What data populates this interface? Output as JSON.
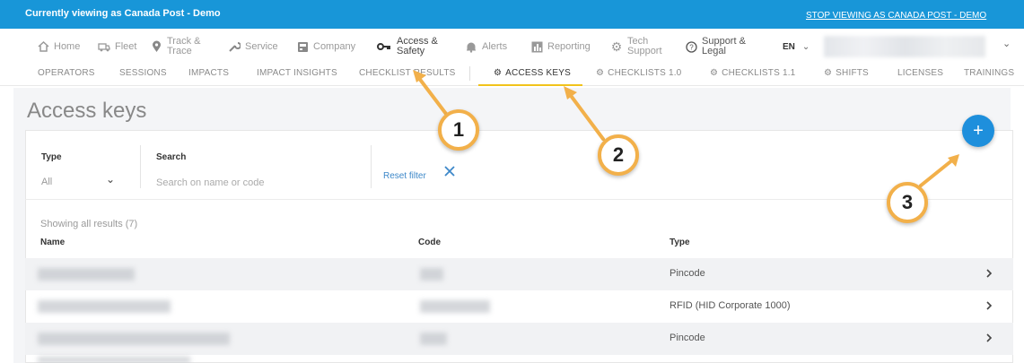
{
  "banner": {
    "text": "Currently viewing as Canada Post - Demo",
    "link": "STOP VIEWING AS CANADA POST - DEMO"
  },
  "nav": {
    "items": [
      {
        "label": "Home",
        "icon": "home-icon"
      },
      {
        "label": "Fleet",
        "icon": "fleet-icon"
      },
      {
        "label_lines": [
          "Track &",
          "Trace"
        ],
        "icon": "map-pin-icon"
      },
      {
        "label": "Service",
        "icon": "wrench-icon"
      },
      {
        "label": "Company",
        "icon": "building-icon"
      },
      {
        "label_lines": [
          "Access &",
          "Safety"
        ],
        "icon": "key-icon",
        "active": true
      },
      {
        "label": "Alerts",
        "icon": "bell-icon"
      },
      {
        "label": "Reporting",
        "icon": "chart-icon"
      },
      {
        "label_lines": [
          "Tech",
          "Support"
        ],
        "icon": "gear-icon"
      },
      {
        "label_lines": [
          "Support &",
          "Legal"
        ],
        "icon": "help-icon"
      }
    ],
    "language": "EN"
  },
  "subnav": {
    "items": [
      {
        "label": "OPERATORS"
      },
      {
        "label": "SESSIONS"
      },
      {
        "label": "IMPACTS"
      },
      {
        "label": "IMPACT INSIGHTS"
      },
      {
        "label": "CHECKLIST RESULTS"
      },
      {
        "label": "ACCESS KEYS",
        "active": true
      },
      {
        "label": "CHECKLISTS 1.0"
      },
      {
        "label": "CHECKLISTS 1.1"
      },
      {
        "label": "SHIFTS"
      },
      {
        "label": "LICENSES"
      },
      {
        "label": "TRAININGS"
      }
    ]
  },
  "page": {
    "title": "Access keys"
  },
  "filters": {
    "type_label": "Type",
    "type_value": "All",
    "search_label": "Search",
    "search_placeholder": "Search on name or code",
    "reset_label": "Reset filter"
  },
  "results": {
    "summary": "Showing all results (7)",
    "columns": [
      "Name",
      "Code",
      "Type"
    ],
    "rows": [
      {
        "type": "Pincode"
      },
      {
        "type": "RFID (HID Corporate 1000)"
      },
      {
        "type": "Pincode"
      }
    ]
  },
  "callouts": [
    "1",
    "2",
    "3"
  ],
  "colors": {
    "banner": "#1896d8",
    "accent": "#f1c31b",
    "callout_ring": "#f2b04a",
    "fab": "#1e8fdc"
  }
}
